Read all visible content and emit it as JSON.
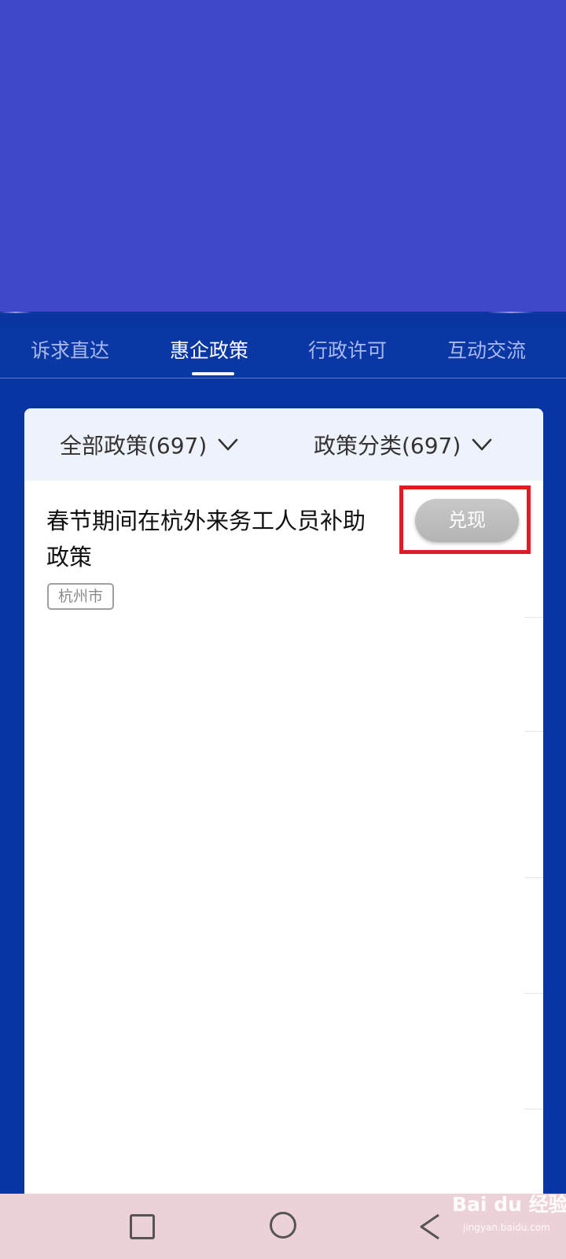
{
  "tabs": [
    {
      "label": "诉求直达",
      "active": false
    },
    {
      "label": "惠企政策",
      "active": true
    },
    {
      "label": "行政许可",
      "active": false
    },
    {
      "label": "互动交流",
      "active": false
    }
  ],
  "filters": {
    "all_policies": "全部政策(697)",
    "policy_category": "政策分类(697)"
  },
  "policy_item": {
    "title": "春节期间在杭外来务工人员补助政策",
    "tag": "杭州市",
    "action_label": "兑现"
  },
  "colors": {
    "hero": "#3f48c9",
    "page_background": "#0735a3",
    "highlight_border": "#e01b24",
    "nav_bar": "#ecd2d6"
  },
  "system_nav": {
    "icons": [
      "recent-apps-icon",
      "home-icon",
      "back-icon"
    ]
  },
  "watermark": {
    "brand": "Bai du 经验",
    "url": "jingyan.baidu.com"
  }
}
